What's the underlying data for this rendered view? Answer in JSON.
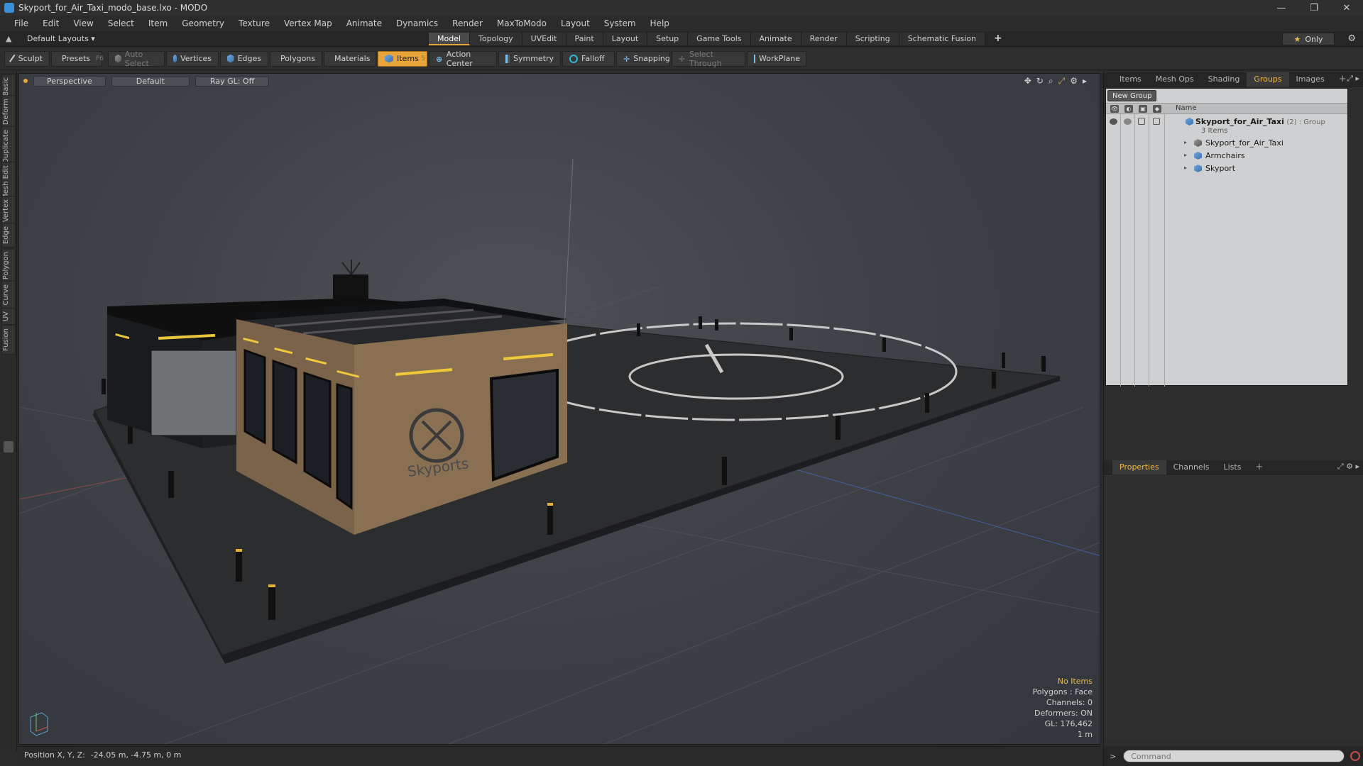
{
  "window": {
    "title": "Skyport_for_Air_Taxi_modo_base.lxo - MODO",
    "controls": [
      "—",
      "❐",
      "✕"
    ]
  },
  "menu": [
    "File",
    "Edit",
    "View",
    "Select",
    "Item",
    "Geometry",
    "Texture",
    "Vertex Map",
    "Animate",
    "Dynamics",
    "Render",
    "MaxToModo",
    "Layout",
    "System",
    "Help"
  ],
  "layouts": {
    "dropdown": "Default Layouts ▾",
    "tabs": [
      "Model",
      "Topology",
      "UVEdit",
      "Paint",
      "Layout",
      "Setup",
      "Game Tools",
      "Animate",
      "Render",
      "Scripting",
      "Schematic Fusion"
    ],
    "active_tab": "Model",
    "add": "+",
    "only_label": "Only"
  },
  "toolbar": {
    "sculpt": "Sculpt",
    "presets": "Presets",
    "presets_key": "F6",
    "auto_select": "Auto Select",
    "vertices": "Vertices",
    "vertices_count": "1",
    "edges": "Edges",
    "edges_count": "2",
    "polygons": "Polygons",
    "materials": "Materials",
    "items": "Items",
    "items_count": "5",
    "action_center": "Action Center",
    "symmetry": "Symmetry",
    "falloff": "Falloff",
    "snapping": "Snapping",
    "select_through": "Select Through",
    "workplane": "WorkPlane"
  },
  "left_tabs": [
    "Basic",
    "Deform",
    "Duplicate",
    "Mesh Edit",
    "Vertex",
    "Edge",
    "Polygon",
    "Curve",
    "UV",
    "Fusion"
  ],
  "viewport": {
    "view": "Perspective",
    "shading": "Default",
    "raygl": "Ray GL: Off",
    "sign_text": "Skyports",
    "info": {
      "selection": "No Items",
      "polygons": "Polygons : Face",
      "channels": "Channels: 0",
      "deformers": "Deformers: ON",
      "gl": "GL: 176,462",
      "scale": "1 m"
    }
  },
  "status": {
    "label": "Position X, Y, Z:",
    "value": "-24.05 m, -4.75 m, 0 m"
  },
  "panel_top": {
    "tabs": [
      "Items",
      "Mesh Ops",
      "Shading",
      "Groups",
      "Images"
    ],
    "active_tab": "Groups",
    "add": "+",
    "new_group": "New Group",
    "column_name": "Name",
    "group": {
      "name": "Skyport_for_Air_Taxi",
      "suffix": "(2) : Group",
      "count": "3 Items"
    },
    "children": [
      "Skyport_for_Air_Taxi",
      "Armchairs",
      "Skyport"
    ]
  },
  "panel_bottom": {
    "tabs": [
      "Properties",
      "Channels",
      "Lists"
    ],
    "active_tab": "Properties",
    "add": "+"
  },
  "command": {
    "placeholder": "Command",
    "arrow": ">"
  },
  "colors": {
    "accent": "#e8a53a",
    "selection_blue": "#3a8fd8"
  }
}
